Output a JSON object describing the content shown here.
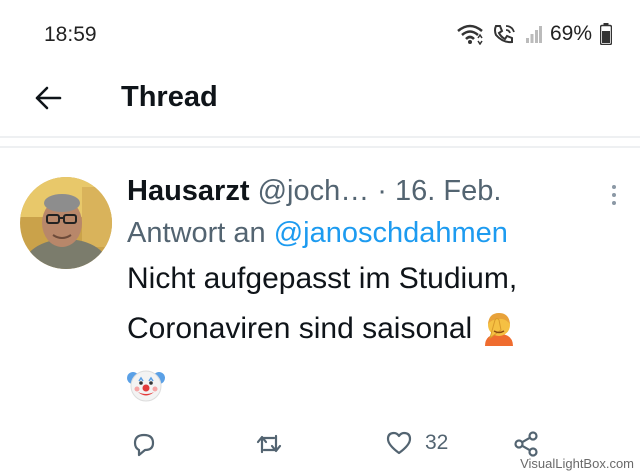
{
  "status_bar": {
    "time": "18:59",
    "battery_percent": "69%",
    "icons": [
      "wifi-icon",
      "wifi-calling-icon",
      "signal-icon",
      "battery-icon"
    ]
  },
  "app_bar": {
    "title": "Thread",
    "back_icon": "arrow-left-icon"
  },
  "tweet": {
    "display_name": "Hausarzt",
    "handle": "@joch…",
    "separator": "·",
    "date": "16. Feb.",
    "reply_prefix": "Antwort an",
    "reply_to": "@janoschdahmen",
    "text_line1": "Nicht aufgepasst im Studium,",
    "text_line2": "Coronaviren sind saisonal",
    "emojis": [
      "facepalm-emoji",
      "clown-emoji"
    ]
  },
  "actions": {
    "like_count": "32"
  },
  "watermark": "VisualLightBox.com",
  "colors": {
    "accent": "#1d9bf0",
    "secondary_text": "#536471",
    "primary_text": "#0f1419"
  }
}
